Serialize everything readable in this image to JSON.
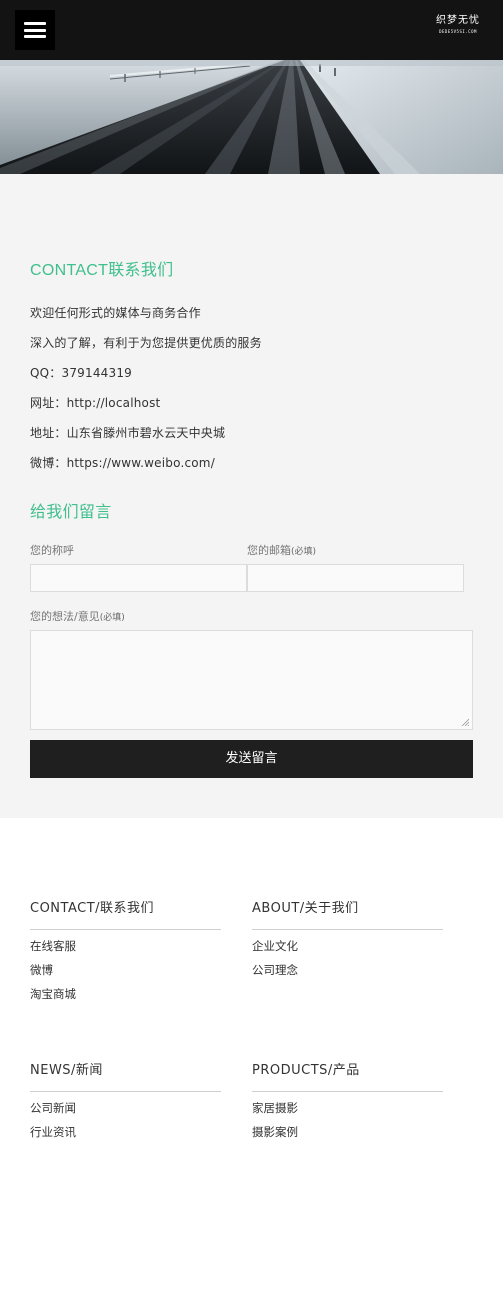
{
  "header": {
    "logo_main": "织梦无忧",
    "logo_sub": "DEDE5V5SI.COM"
  },
  "contact": {
    "title": "CONTACT联系我们",
    "lines": [
      "欢迎任何形式的媒体与商务合作",
      "深入的了解，有利于为您提供更优质的服务",
      "QQ：379144319",
      "网址：http://localhost",
      "地址：山东省滕州市碧水云天中央城",
      "微博：https://www.weibo.com/"
    ]
  },
  "message_form": {
    "title": "给我们留言",
    "name_label": "您的称呼",
    "email_label": "您的邮箱",
    "email_required": "(必填)",
    "opinion_label": "您的想法/意见",
    "opinion_required": "(必填)",
    "submit_label": "发送留言"
  },
  "footer": {
    "columns": [
      {
        "title": "CONTACT/联系我们",
        "links": [
          "在线客服",
          "微博",
          "淘宝商城"
        ]
      },
      {
        "title": "ABOUT/关于我们",
        "links": [
          "企业文化",
          "公司理念"
        ]
      },
      {
        "title": "NEWS/新闻",
        "links": [
          "公司新闻",
          "行业资讯"
        ]
      },
      {
        "title": "PRODUCTS/产品",
        "links": [
          "家居摄影",
          "摄影案例"
        ]
      }
    ]
  }
}
